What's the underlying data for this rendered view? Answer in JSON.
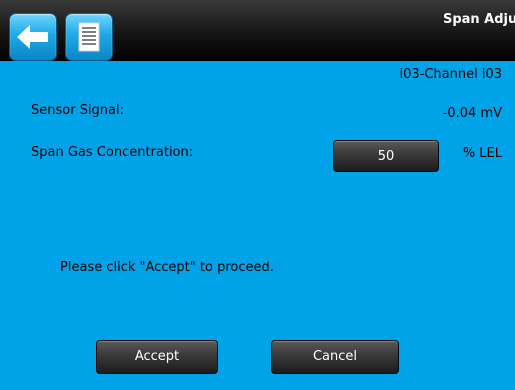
{
  "header": {
    "title": "Span Adjus",
    "back_icon": "back-arrow-icon",
    "doc_icon": "document-icon"
  },
  "channel": {
    "name": "i03-Channel i03"
  },
  "sensor_signal": {
    "label": "Sensor Signal:",
    "value": "-0.04 mV"
  },
  "span_gas": {
    "label": "Span Gas Concentration:",
    "value": "50",
    "unit": "% LEL"
  },
  "message": "Please click \"Accept\" to proceed.",
  "actions": {
    "accept_label": "Accept",
    "cancel_label": "Cancel"
  },
  "colors": {
    "background": "#00a2e8",
    "header": "#151515",
    "button": "#3c3c3c",
    "icon_button": "#1fa8e6"
  }
}
